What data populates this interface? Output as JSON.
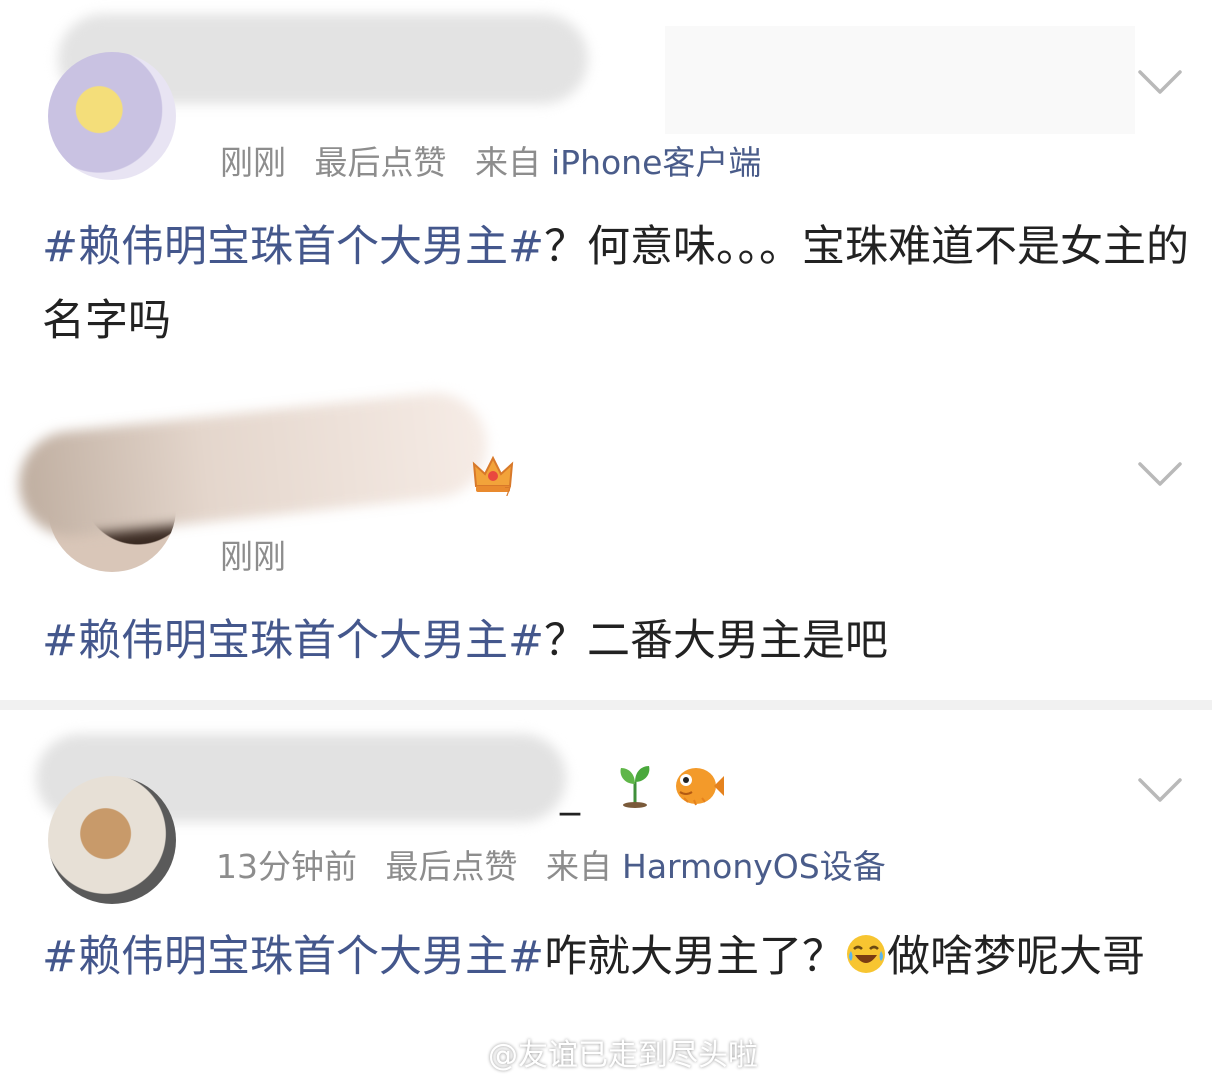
{
  "comments": [
    {
      "meta": {
        "time": "刚刚",
        "liked": "最后点赞",
        "from_prefix": "来自",
        "source": "iPhone客户端"
      },
      "hashtag": "#赖伟明宝珠首个大男主#",
      "text": "？何意味。。。宝珠难道不是女主的名字吗"
    },
    {
      "meta": {
        "time": "刚刚"
      },
      "hashtag": "#赖伟明宝珠首个大男主#",
      "text": "？二番大男主是吧"
    },
    {
      "name_tail": "_",
      "meta": {
        "time": "13分钟前",
        "liked": "最后点赞",
        "from_prefix": "来自",
        "source": "HarmonyOS设备"
      },
      "hashtag": "#赖伟明宝珠首个大男主#",
      "text_before_emoji": "咋就大男主了？",
      "text_after_emoji": "做啥梦呢大哥"
    }
  ],
  "watermark": "@友谊已走到尽头啦",
  "icons": {
    "chevron": "chevron-down-icon",
    "crown": "crown-badge-icon",
    "sprout": "sprout-icon",
    "fish": "pufferfish-icon",
    "laugh": "laugh-cry-emoji",
    "weibo": "weibo-logo-icon"
  },
  "colors": {
    "link": "#44578c",
    "meta": "#8d8d8d",
    "text": "#222222"
  }
}
